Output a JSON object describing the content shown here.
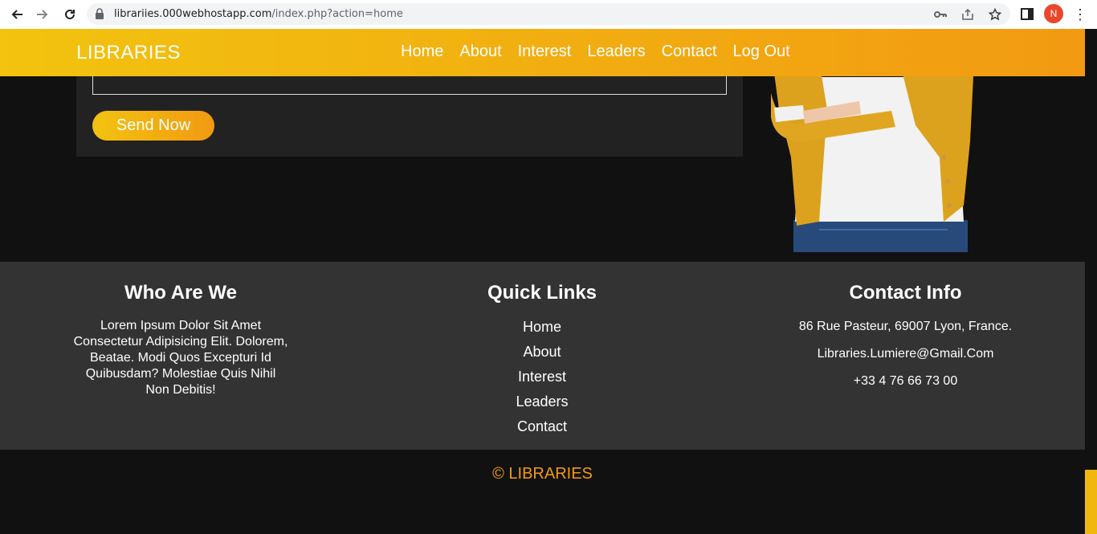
{
  "browser": {
    "url_host": "librariies.000webhostapp.com",
    "url_path": "/index.php?action=home",
    "avatar_letter": "N"
  },
  "header": {
    "logo": "LIBRARIES",
    "nav": [
      "Home",
      "About",
      "Interest",
      "Leaders",
      "Contact",
      "Log Out"
    ]
  },
  "form": {
    "send_label": "Send Now"
  },
  "footer": {
    "who": {
      "title": "Who Are We",
      "text": "Lorem Ipsum Dolor Sit Amet Consectetur Adipisicing Elit. Dolorem, Beatae. Modi Quos Excepturi Id Quibusdam? Molestiae Quis Nihil Non Debitis!"
    },
    "links": {
      "title": "Quick Links",
      "items": [
        "Home",
        "About",
        "Interest",
        "Leaders",
        "Contact"
      ]
    },
    "contact": {
      "title": "Contact Info",
      "address": "86 Rue Pasteur, 69007 Lyon, France.",
      "email": "Libraries.Lumiere@Gmail.Com",
      "phone": "+33 4 76 66 73 00"
    }
  },
  "copyright": "© LIBRARIES",
  "colors": {
    "accent_start": "#f2c30f",
    "accent_end": "#f29a12",
    "footer_bg": "#333333",
    "page_bg": "#111111"
  }
}
